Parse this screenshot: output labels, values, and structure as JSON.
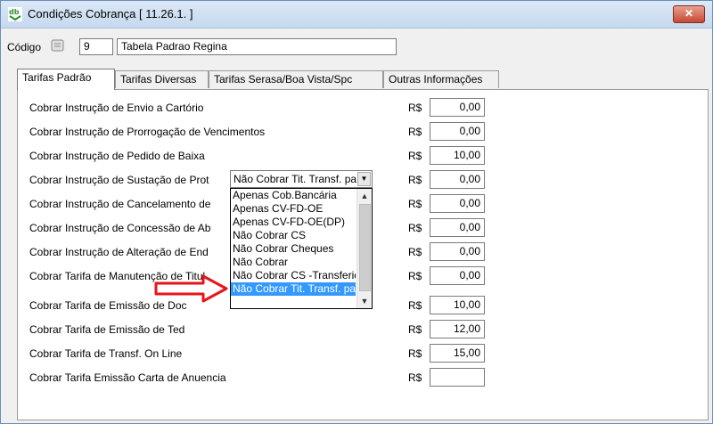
{
  "window": {
    "title": "Condições Cobrança [ 11.26.1. ]",
    "app_icon": "db-app-icon",
    "close_label": "✕"
  },
  "header": {
    "codigo_label": "Código",
    "codigo_value": "9",
    "nome_value": "Tabela Padrao Regina"
  },
  "tabs": [
    {
      "label": "Tarifas Padrão",
      "active": true
    },
    {
      "label": "Tarifas Diversas",
      "active": false
    },
    {
      "label": "Tarifas Serasa/Boa Vista/Spc",
      "active": false
    },
    {
      "label": "Outras Informações",
      "active": false
    }
  ],
  "currency": "R$",
  "rows": [
    {
      "label": "Cobrar Instrução de Envio a Cartório",
      "value": "0,00"
    },
    {
      "label": "Cobrar Instrução de Prorrogação de Vencimentos",
      "value": "0,00"
    },
    {
      "label": "Cobrar Instrução de Pedido de Baixa",
      "value": "10,00"
    },
    {
      "label": "Cobrar Instrução de Sustação de Prot",
      "value": "0,00"
    },
    {
      "label": "Cobrar Instrução de Cancelamento de",
      "value": "0,00"
    },
    {
      "label": "Cobrar Instrução de Concessão de Ab",
      "value": "0,00"
    },
    {
      "label": "Cobrar Instrução de Alteração de End",
      "value": "0,00"
    },
    {
      "label": "Cobrar Tarifa de Manutenção de Titul",
      "value": "0,00"
    },
    {
      "label": "Cobrar Tarifa de Emissão de  Doc",
      "value": "10,00"
    },
    {
      "label": "Cobrar Tarifa de Emissão de  Ted",
      "value": "12,00"
    },
    {
      "label": "Cobrar Tarifa de Transf. On Line",
      "value": "15,00"
    },
    {
      "label": "Cobrar Tarifa Emissão Carta de Anuencia",
      "value": ""
    }
  ],
  "baixa_combo": {
    "selected": "Não Cobrar Tit. Transf. pa",
    "options": [
      "Apenas Cob.Bancária",
      "Apenas CV-FD-OE",
      "Apenas CV-FD-OE(DP)",
      "Não Cobrar CS",
      "Não Cobrar Cheques",
      "Não Cobrar",
      "Não Cobrar CS -Transferic",
      "Não Cobrar Tit. Transf. pa"
    ],
    "highlighted_index": 7
  },
  "colors": {
    "selection": "#3399ff",
    "arrow": "#e8141b",
    "close_button": "#c74a33"
  }
}
